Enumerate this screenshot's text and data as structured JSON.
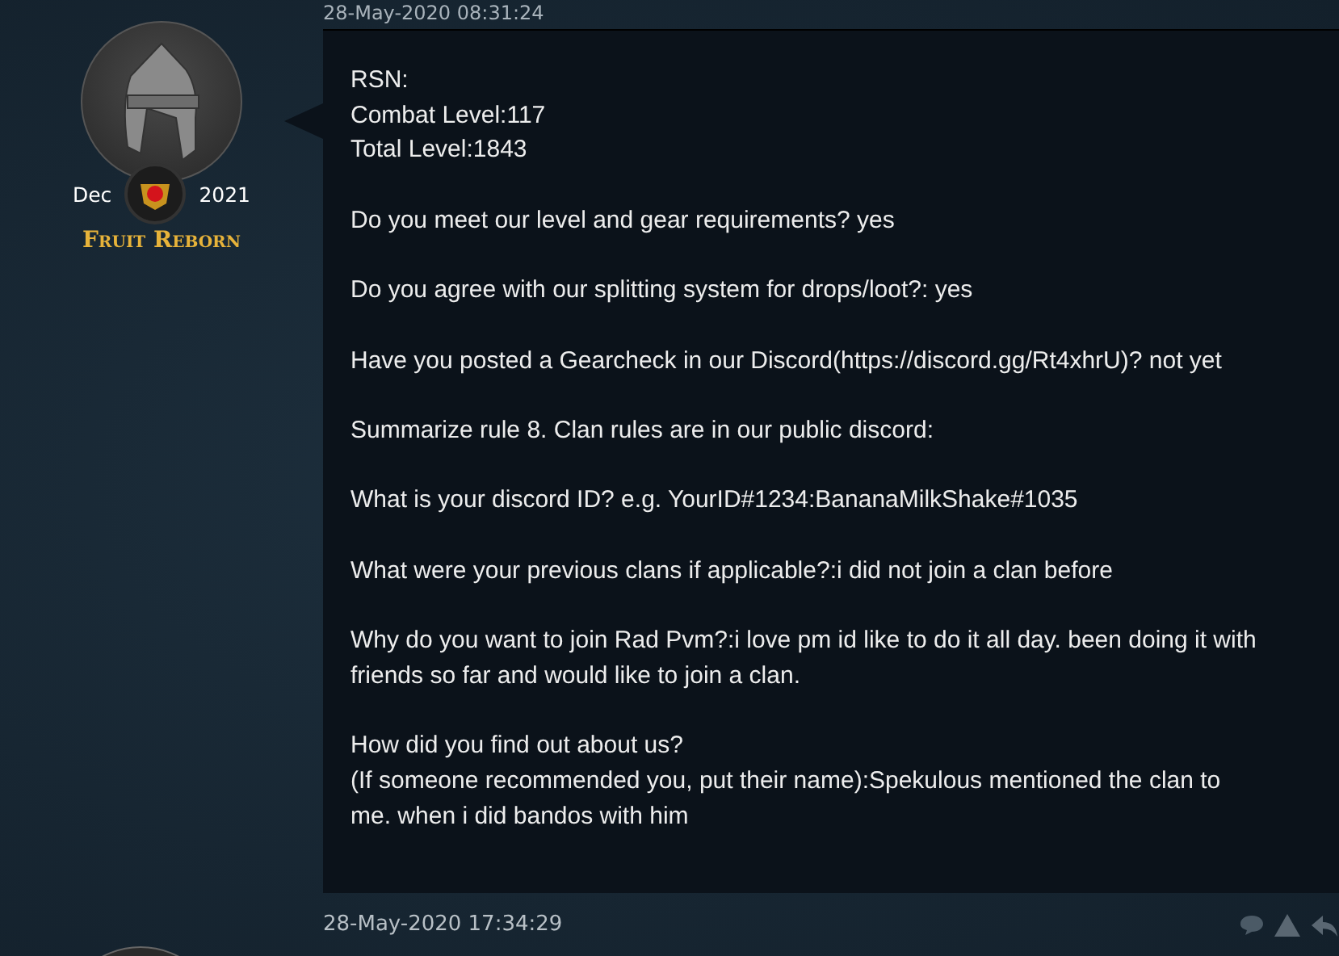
{
  "post_top": {
    "timestamp": "28-May-2020 08:31:24"
  },
  "author": {
    "join_month": "Dec",
    "join_year": "2021",
    "name": "Fruit Reborn"
  },
  "post": {
    "paragraphs": [
      [
        "RSN:",
        "Combat Level:117",
        "Total Level:1843"
      ],
      [
        "Do you meet our level and gear requirements? yes"
      ],
      [
        "Do you agree with our splitting system for drops/loot?: yes"
      ],
      [
        "Have you posted a Gearcheck in our Discord(https://discord.gg/Rt4xhrU)? not yet"
      ],
      [
        "Summarize rule 8. Clan rules are in our public discord:"
      ],
      [
        "What is your discord ID? e.g. YourID#1234:BananaMilkShake#1035"
      ],
      [
        "What were your previous clans if applicable?:i did not join a clan before"
      ],
      [
        "Why do you want to join Rad Pvm?:i love pm id like to do it all day. been doing it with",
        "friends so far and would like to join a clan."
      ],
      [
        "How did you find out about us?",
        "(If someone recommended you, put their name):Spekulous mentioned the clan to",
        "me. when i did bandos with him"
      ]
    ]
  },
  "next_post": {
    "timestamp": "28-May-2020 17:34:29"
  }
}
